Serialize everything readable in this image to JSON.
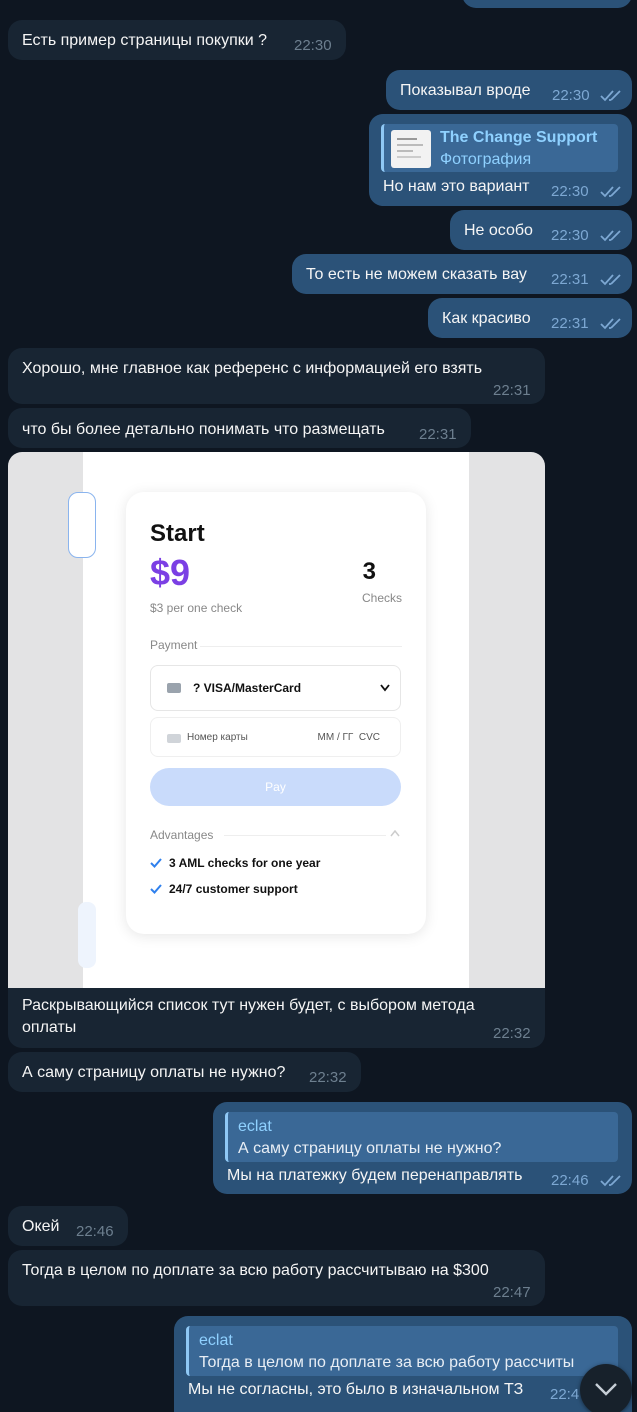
{
  "messages": [
    {
      "text": "Есть пример страницы покупки ?",
      "time": "22:30"
    },
    {
      "text": "Показывал вроде",
      "time": "22:30"
    },
    {
      "reply_name": "The Change Support",
      "reply_text": "Фотография",
      "text": "Но нам это вариант",
      "time": "22:30"
    },
    {
      "text": "Не особо",
      "time": "22:30"
    },
    {
      "text": "То есть не можем сказать вау",
      "time": "22:31"
    },
    {
      "text": "Как красиво",
      "time": "22:31"
    },
    {
      "text": "Хорошо, мне главное как референс с информацией его взять",
      "time": "22:31"
    },
    {
      "text": "что бы более детально понимать что размещать",
      "time": "22:31"
    },
    {
      "caption_line1": "Раскрывающийся список тут нужен будет, с выбором метода",
      "caption_line2": "оплаты",
      "time": "22:32"
    },
    {
      "text": "А саму страницу оплаты не нужно?",
      "time": "22:32"
    },
    {
      "reply_name": "eclat",
      "reply_text": "А саму страницу оплаты не нужно?",
      "text": "Мы на платежку будем перенаправлять",
      "time": "22:46"
    },
    {
      "text": "Окей",
      "time": "22:46"
    },
    {
      "text": "Тогда в целом по доплате за всю работу рассчитываю на $300",
      "time": "22:47"
    },
    {
      "reply_name": "eclat",
      "reply_text": "Тогда в целом по доплате за всю работу рассчиты",
      "text": "Мы не согласны, это было в изначальном ТЗ",
      "time": "22:4"
    }
  ],
  "pricing_card": {
    "plan": "Start",
    "price": "$9",
    "count": "3",
    "count_label": "Checks",
    "per_check": "$3 per one check",
    "payment_label": "Payment",
    "method": "? VISA/MasterCard",
    "card_placeholder": "Номер карты",
    "expiry_cvc": "ММ / ГГ  CVC",
    "pay_button": "Pay",
    "advantages_label": "Advantages",
    "advantages": [
      "3 AML checks for one year",
      "24/7 customer support"
    ]
  },
  "colors": {
    "background": "#0e1621",
    "incoming": "#182533",
    "outgoing": "#2b5278",
    "price_purple": "#7b3fe4",
    "pay_button": "#c9dbfb"
  }
}
